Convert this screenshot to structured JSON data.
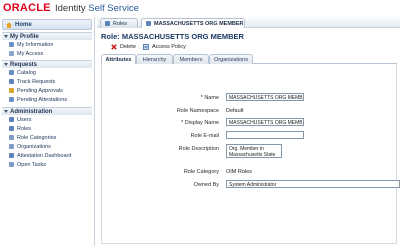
{
  "header": {
    "brand": "ORACLE",
    "product_prefix": "Identity ",
    "product_highlight": "Self Service"
  },
  "sidebar": {
    "home_label": "Home",
    "sections": [
      {
        "title": "My Profile",
        "items": [
          {
            "label": "My Information",
            "color": "#6a8fc2"
          },
          {
            "label": "My Access",
            "color": "#8aa7cf"
          }
        ]
      },
      {
        "title": "Requests",
        "items": [
          {
            "label": "Catalog",
            "color": "#6a8fc2"
          },
          {
            "label": "Track Requests",
            "color": "#5d84b9"
          },
          {
            "label": "Pending Approvals",
            "color": "#d4a52f"
          },
          {
            "label": "Pending Attestations",
            "color": "#6a8fc2"
          }
        ]
      },
      {
        "title": "Administration",
        "items": [
          {
            "label": "Users",
            "color": "#5d84b9"
          },
          {
            "label": "Roles",
            "color": "#5d84b9"
          },
          {
            "label": "Role Categories",
            "color": "#7d9cc8"
          },
          {
            "label": "Organizations",
            "color": "#7d9cc8"
          },
          {
            "label": "Attestation Dashboard",
            "color": "#5d84b9"
          },
          {
            "label": "Open Tasks",
            "color": "#7d9cc8"
          }
        ]
      }
    ]
  },
  "tabs": [
    {
      "label": "Roles"
    },
    {
      "label": "MASSACHUSETTS ORG MEMBER"
    }
  ],
  "role": {
    "title": "Role: MASSACHUSETTS ORG MEMBER",
    "actions": {
      "delete": "Delete",
      "access_policy": "Access Policy"
    }
  },
  "subtabs": [
    {
      "label": "Attributes"
    },
    {
      "label": "Hierarchy"
    },
    {
      "label": "Members"
    },
    {
      "label": "Organizations"
    }
  ],
  "form": {
    "name": {
      "label": "Name",
      "value": "MASSACHUSETTS ORG MEMBER"
    },
    "namespace": {
      "label": "Role Namespace",
      "value": "Default"
    },
    "display_name": {
      "label": "Display Name",
      "value": "MASSACHUSETTS ORG MEMBER"
    },
    "email": {
      "label": "Role E-mail",
      "value": ""
    },
    "description": {
      "label": "Role Description",
      "value": "Org. Member in Massachusetts State"
    },
    "category": {
      "label": "Role Category",
      "value": "OIM Roles"
    },
    "owned_by": {
      "label": "Owned By",
      "value": "System Administrator"
    }
  },
  "colors": {
    "brand_red": "#e0001b",
    "accent_blue": "#1c3a63"
  }
}
